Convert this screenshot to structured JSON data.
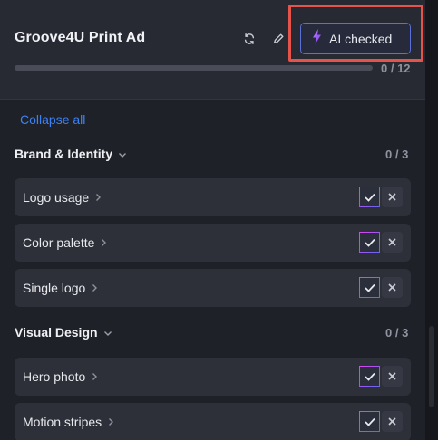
{
  "header": {
    "title": "Groove4U Print Ad",
    "ai_button_label": "AI checked",
    "progress_text": "0 / 12",
    "progress_fraction": 0
  },
  "collapse_label": "Collapse all",
  "sections": [
    {
      "name": "Brand & Identity",
      "count": "0 / 3",
      "items": [
        {
          "label": "Logo usage"
        },
        {
          "label": "Color palette"
        },
        {
          "label": "Single logo"
        }
      ]
    },
    {
      "name": "Visual Design",
      "count": "0 / 3",
      "items": [
        {
          "label": "Hero photo"
        },
        {
          "label": "Motion stripes"
        }
      ]
    }
  ],
  "colors": {
    "accent_blue": "#3b82f6",
    "highlight_red": "#e5534b",
    "ai_border": "#5a6fd8"
  },
  "icons": [
    "refresh-icon",
    "pencil-icon",
    "lightning-icon",
    "chevron-down-icon",
    "chevron-right-icon",
    "check-icon",
    "close-icon"
  ]
}
